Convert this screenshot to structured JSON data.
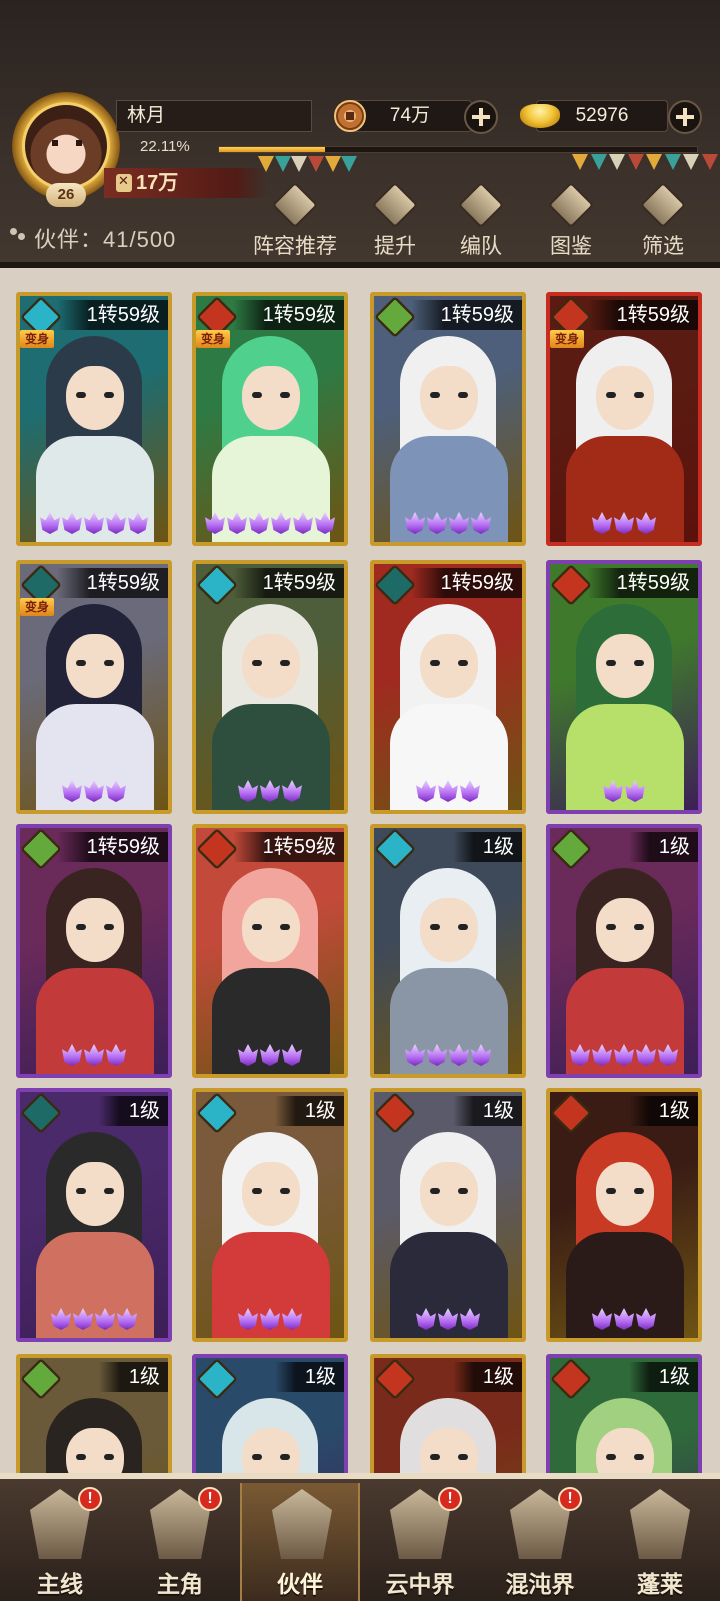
{
  "player": {
    "name": "林月",
    "level": "26",
    "exp_percent": "22.11%",
    "exp_fraction": 0.2211,
    "power": "17万"
  },
  "resources": {
    "copper": "74万",
    "gold": "52976"
  },
  "partners": {
    "count_label": "伙伴：41/500"
  },
  "toolbar": [
    {
      "label": "阵容推荐",
      "icon": "formation-recommend-icon"
    },
    {
      "label": "提升",
      "icon": "upgrade-icon"
    },
    {
      "label": "编队",
      "icon": "team-icon"
    },
    {
      "label": "图鉴",
      "icon": "codex-icon"
    },
    {
      "label": "筛选",
      "icon": "filter-icon"
    }
  ],
  "cards": [
    {
      "level": "1转59级",
      "element": "water",
      "transformed": true,
      "frame": "gold",
      "stars": 5,
      "palette": [
        "#1d6d72",
        "#2b3b4a",
        "#dfe9ea"
      ]
    },
    {
      "level": "1转59级",
      "element": "fire",
      "transformed": true,
      "frame": "gold",
      "stars": 6,
      "palette": [
        "#2e7a44",
        "#4fd18d",
        "#e6f5d8"
      ]
    },
    {
      "level": "1转59级",
      "element": "wood",
      "transformed": false,
      "frame": "gold",
      "stars": 4,
      "palette": [
        "#4d5f7a",
        "#f0f0f0",
        "#7d94b8"
      ]
    },
    {
      "level": "1转59级",
      "element": "fire",
      "transformed": true,
      "frame": "red",
      "stars": 3,
      "palette": [
        "#5a1c12",
        "#efefef",
        "#a22b18"
      ]
    },
    {
      "level": "1转59级",
      "element": "dark",
      "transformed": true,
      "frame": "gold",
      "stars": 3,
      "palette": [
        "#6a6a7a",
        "#222238",
        "#e4e4f0"
      ]
    },
    {
      "level": "1转59级",
      "element": "water",
      "transformed": false,
      "frame": "gold",
      "stars": 3,
      "palette": [
        "#4e5e3a",
        "#e8e8e0",
        "#2f4f3e"
      ]
    },
    {
      "level": "1转59级",
      "element": "dark",
      "transformed": false,
      "frame": "gold",
      "stars": 3,
      "palette": [
        "#a02a20",
        "#f2f2f2",
        "#f7f7f7"
      ]
    },
    {
      "level": "1转59级",
      "element": "fire",
      "transformed": false,
      "frame": "purple",
      "stars": 2,
      "palette": [
        "#3f7a2c",
        "#2d6d3a",
        "#b7e06a"
      ]
    },
    {
      "level": "1转59级",
      "element": "wood",
      "transformed": false,
      "frame": "purple",
      "stars": 3,
      "palette": [
        "#6a2a5a",
        "#3a2422",
        "#c33a3a"
      ]
    },
    {
      "level": "1转59级",
      "element": "fire",
      "transformed": false,
      "frame": "gold",
      "stars": 3,
      "palette": [
        "#c34a3a",
        "#f2a59c",
        "#2a2a2a"
      ]
    },
    {
      "level": "1级",
      "element": "water",
      "transformed": false,
      "frame": "gold",
      "stars": 4,
      "palette": [
        "#3e4a5a",
        "#e8eef2",
        "#8a96a6"
      ]
    },
    {
      "level": "1级",
      "element": "wood",
      "transformed": false,
      "frame": "purple",
      "stars": 5,
      "palette": [
        "#6a2a5a",
        "#3a2422",
        "#c33a3a"
      ]
    },
    {
      "level": "1级",
      "element": "dark",
      "transformed": false,
      "frame": "purple",
      "stars": 4,
      "palette": [
        "#4a2a6a",
        "#2a2a2a",
        "#d07060"
      ]
    },
    {
      "level": "1级",
      "element": "water",
      "transformed": false,
      "frame": "gold",
      "stars": 3,
      "palette": [
        "#7a5a3a",
        "#f2f2f2",
        "#d33a3a"
      ]
    },
    {
      "level": "1级",
      "element": "fire",
      "transformed": false,
      "frame": "gold",
      "stars": 3,
      "palette": [
        "#5a5a6a",
        "#f0f0f0",
        "#2a2a3a"
      ]
    },
    {
      "level": "1级",
      "element": "fire",
      "transformed": false,
      "frame": "gold",
      "stars": 3,
      "palette": [
        "#3a1c14",
        "#c93a24",
        "#2a1a18"
      ]
    },
    {
      "level": "1级",
      "element": "wood",
      "transformed": false,
      "frame": "gold",
      "stars": 0,
      "palette": [
        "#6a5a3a",
        "#2a2420",
        "#d0b080"
      ]
    },
    {
      "level": "1级",
      "element": "water",
      "transformed": false,
      "frame": "purple",
      "stars": 0,
      "palette": [
        "#2a4a6a",
        "#d8e6ea",
        "#3a6a8a"
      ]
    },
    {
      "level": "1级",
      "element": "fire",
      "transformed": false,
      "frame": "gold",
      "stars": 0,
      "palette": [
        "#7a2a1a",
        "#e0dede",
        "#c9472a"
      ]
    },
    {
      "level": "1级",
      "element": "fire",
      "transformed": false,
      "frame": "purple",
      "stars": 0,
      "palette": [
        "#2f6a3a",
        "#a0d080",
        "#e0f0d0"
      ]
    }
  ],
  "transform_label": "变身",
  "nav": [
    {
      "label": "主线",
      "alert": true,
      "active": false
    },
    {
      "label": "主角",
      "alert": true,
      "active": false
    },
    {
      "label": "伙伴",
      "alert": false,
      "active": true
    },
    {
      "label": "云中界",
      "alert": true,
      "active": false
    },
    {
      "label": "混沌界",
      "alert": true,
      "active": false
    },
    {
      "label": "蓬莱",
      "alert": false,
      "active": false
    }
  ],
  "alert_symbol": "!",
  "colors": {
    "accent": "#e29a17",
    "power_bg": "#7a2d22",
    "alert": "#d72a1f"
  }
}
